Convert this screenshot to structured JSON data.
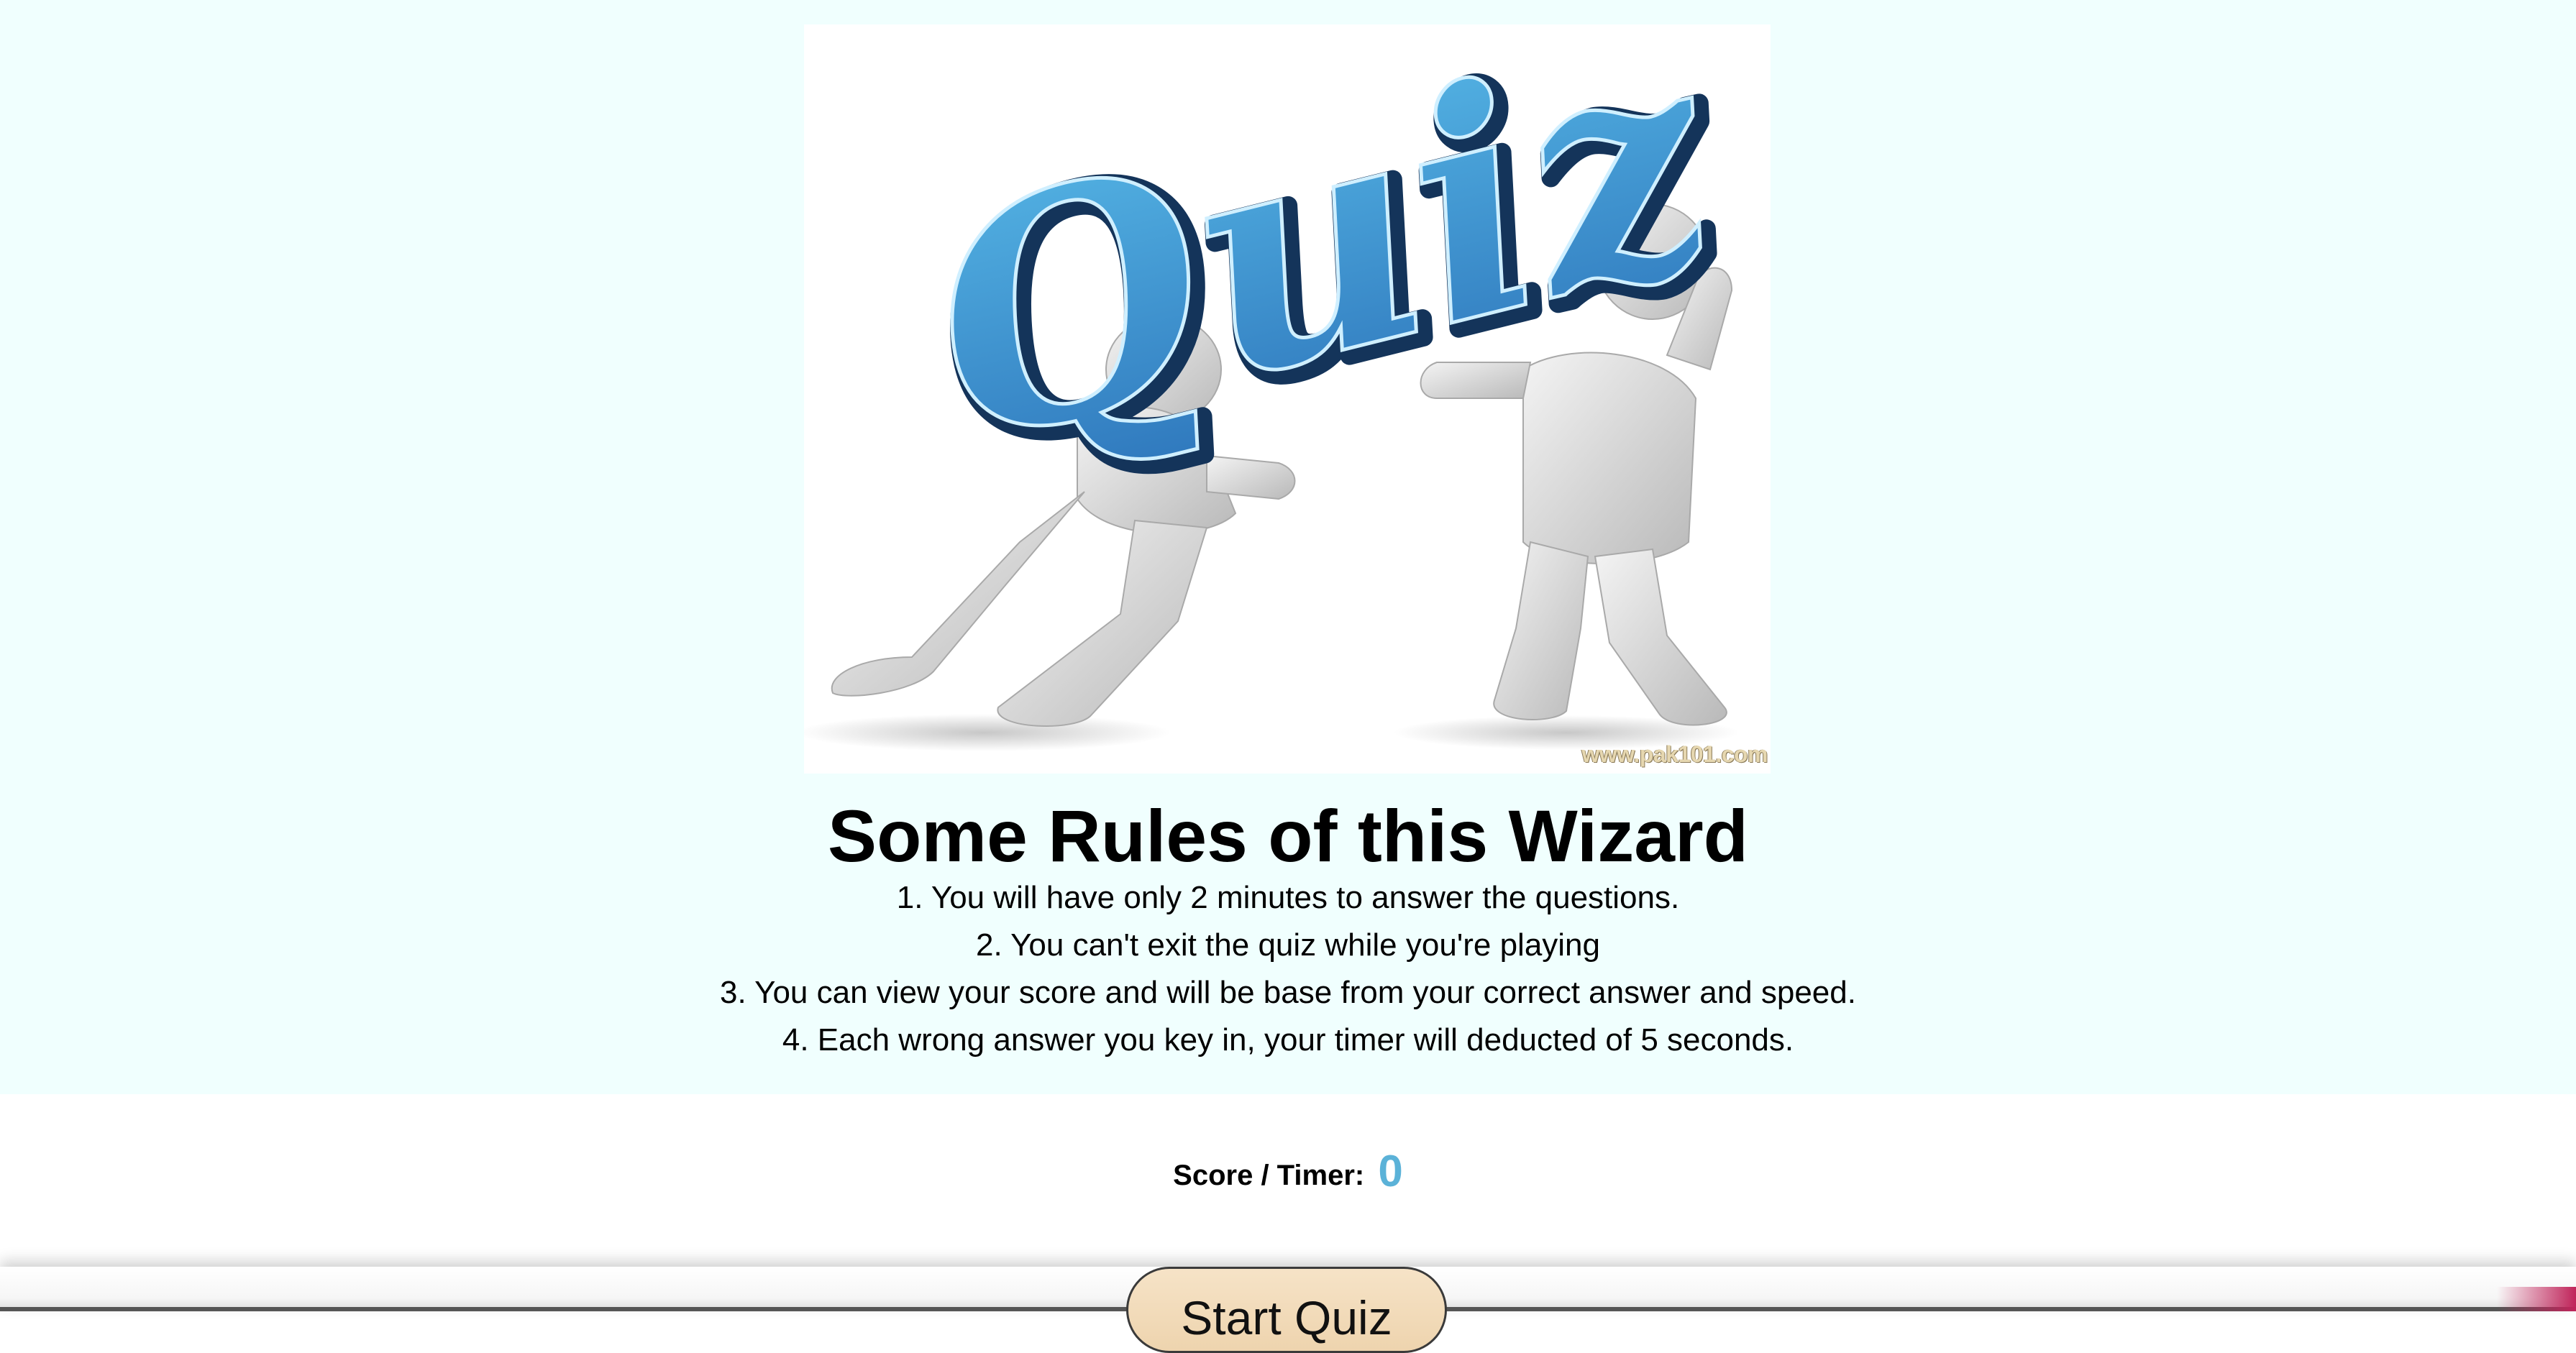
{
  "hero": {
    "logo_text": "Quiz",
    "watermark": "www.pak101.com"
  },
  "rules": {
    "title": "Some Rules of this Wizard",
    "items": [
      "1. You will have only 2 minutes to answer the questions.",
      "2. You can't exit the quiz while you're playing",
      "3. You can view your score and will be base from your correct answer and speed.",
      "4. Each wrong answer you key in, your timer will deducted of 5 seconds."
    ]
  },
  "score": {
    "label": "Score / Timer:",
    "value": "0"
  },
  "actions": {
    "start_label": "Start Quiz"
  },
  "colors": {
    "page_background": "#f0fffe",
    "score_value": "#5bb2d8",
    "button_fill": "#f2dbb9",
    "logo_blue": "#3a8fd0"
  }
}
